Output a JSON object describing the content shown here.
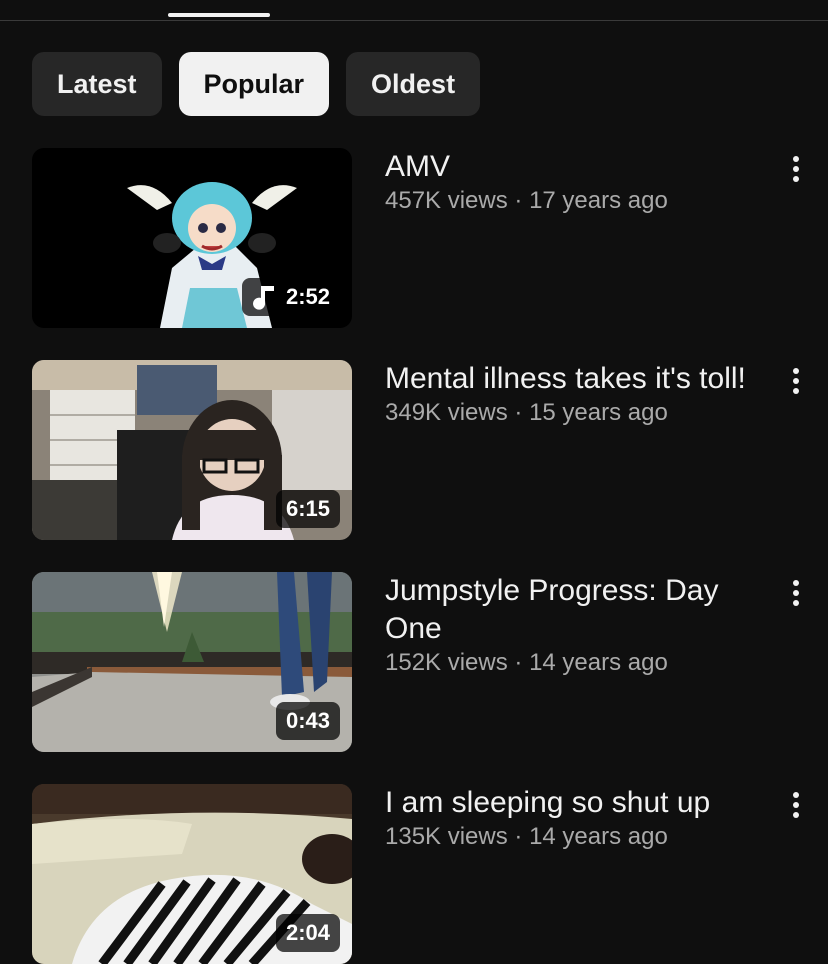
{
  "chips": [
    {
      "label": "Latest",
      "selected": false
    },
    {
      "label": "Popular",
      "selected": true
    },
    {
      "label": "Oldest",
      "selected": false
    }
  ],
  "videos": [
    {
      "title": "AMV",
      "views": "457K views",
      "age": "17 years ago",
      "duration": "2:52",
      "has_music_icon": true,
      "icon": "music-note-icon"
    },
    {
      "title": "Mental illness takes it's toll!",
      "views": "349K views",
      "age": "15 years ago",
      "duration": "6:15"
    },
    {
      "title": "Jumpstyle Progress: Day One",
      "views": "152K views",
      "age": "14 years ago",
      "duration": "0:43"
    },
    {
      "title": "I am sleeping so shut up",
      "views": "135K views",
      "age": "14 years ago",
      "duration": "2:04"
    }
  ],
  "meta_separator": " · ",
  "more_icon": "more-vertical-icon",
  "colors": {
    "background": "#0f0f0f",
    "chip": "#272727",
    "chip_selected": "#f1f1f1",
    "meta_text": "#aaaaaa"
  }
}
